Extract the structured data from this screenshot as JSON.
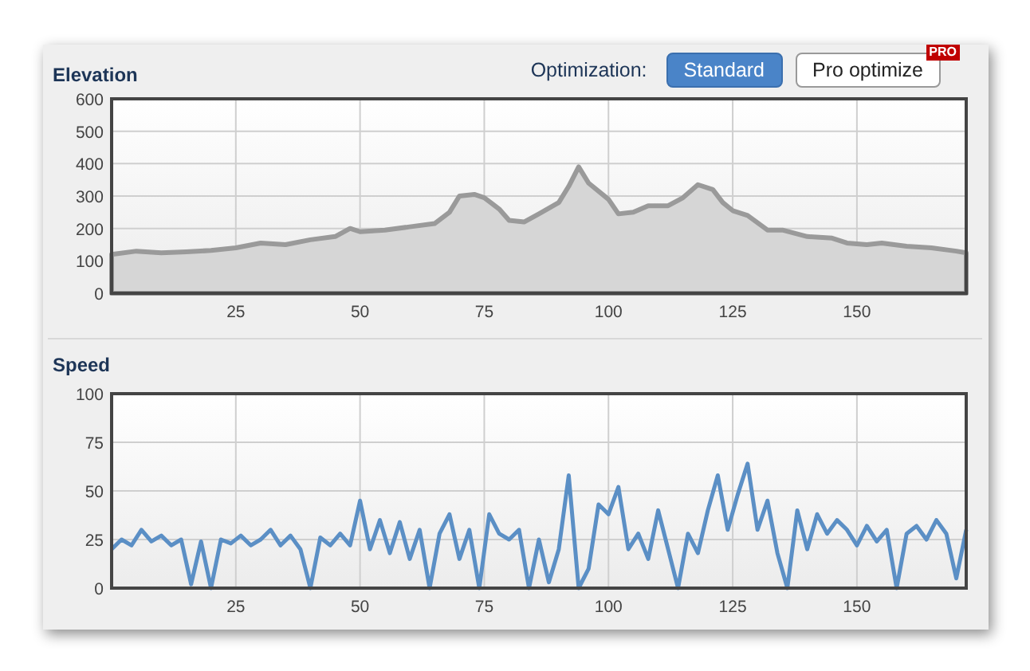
{
  "elevation": {
    "title": "Elevation",
    "optimization": {
      "label": "Optimization:",
      "options": [
        {
          "label": "Standard",
          "selected": true
        },
        {
          "label": "Pro optimize",
          "selected": false,
          "badge": "PRO"
        }
      ]
    },
    "chart_data": {
      "type": "area",
      "x": [
        0,
        5,
        10,
        15,
        20,
        25,
        30,
        35,
        40,
        45,
        48,
        50,
        55,
        60,
        65,
        68,
        70,
        73,
        75,
        78,
        80,
        83,
        86,
        90,
        92,
        94,
        96,
        100,
        102,
        105,
        108,
        112,
        115,
        118,
        121,
        123,
        125,
        128,
        132,
        135,
        140,
        145,
        148,
        152,
        155,
        160,
        165,
        170,
        172
      ],
      "grid": true,
      "series": [
        {
          "color": "#9a9a9a",
          "values": [
            120,
            130,
            125,
            128,
            132,
            140,
            155,
            150,
            165,
            175,
            200,
            190,
            195,
            205,
            215,
            250,
            300,
            305,
            295,
            260,
            225,
            220,
            245,
            280,
            330,
            390,
            340,
            290,
            245,
            250,
            270,
            270,
            295,
            335,
            320,
            280,
            255,
            240,
            195,
            195,
            175,
            170,
            155,
            150,
            155,
            145,
            140,
            130,
            125
          ]
        }
      ],
      "xlim": [
        0,
        172
      ],
      "ylim": [
        0,
        600
      ],
      "xticks": [
        25,
        50,
        75,
        100,
        125,
        150
      ],
      "yticks": [
        0,
        100,
        200,
        300,
        400,
        500,
        600
      ]
    }
  },
  "speed": {
    "title": "Speed",
    "chart_data": {
      "type": "line",
      "x": [
        0,
        2,
        4,
        6,
        8,
        10,
        12,
        14,
        16,
        18,
        20,
        22,
        24,
        26,
        28,
        30,
        32,
        34,
        36,
        38,
        40,
        42,
        44,
        46,
        48,
        50,
        52,
        54,
        56,
        58,
        60,
        62,
        64,
        66,
        68,
        70,
        72,
        74,
        76,
        78,
        80,
        82,
        84,
        86,
        88,
        90,
        92,
        94,
        96,
        98,
        100,
        102,
        104,
        106,
        108,
        110,
        112,
        114,
        116,
        118,
        120,
        122,
        124,
        126,
        128,
        130,
        132,
        134,
        136,
        138,
        140,
        142,
        144,
        146,
        148,
        150,
        152,
        154,
        156,
        158,
        160,
        162,
        164,
        166,
        168,
        170,
        172
      ],
      "grid": true,
      "series": [
        {
          "color": "#5b8fc5",
          "values": [
            20,
            25,
            22,
            30,
            24,
            27,
            22,
            25,
            2,
            24,
            0,
            25,
            23,
            27,
            22,
            25,
            30,
            22,
            27,
            20,
            0,
            26,
            22,
            28,
            22,
            45,
            20,
            35,
            18,
            34,
            15,
            30,
            0,
            28,
            38,
            15,
            30,
            0,
            38,
            28,
            25,
            30,
            0,
            25,
            3,
            20,
            58,
            0,
            10,
            43,
            38,
            52,
            20,
            28,
            15,
            40,
            20,
            0,
            28,
            18,
            40,
            58,
            30,
            48,
            64,
            30,
            45,
            18,
            0,
            40,
            20,
            38,
            28,
            35,
            30,
            22,
            32,
            24,
            30,
            0,
            28,
            32,
            25,
            35,
            28,
            5,
            30
          ]
        }
      ],
      "xlim": [
        0,
        172
      ],
      "ylim": [
        0,
        100
      ],
      "xticks": [
        25,
        50,
        75,
        100,
        125,
        150
      ],
      "yticks": [
        0,
        25,
        50,
        75,
        100
      ]
    }
  }
}
